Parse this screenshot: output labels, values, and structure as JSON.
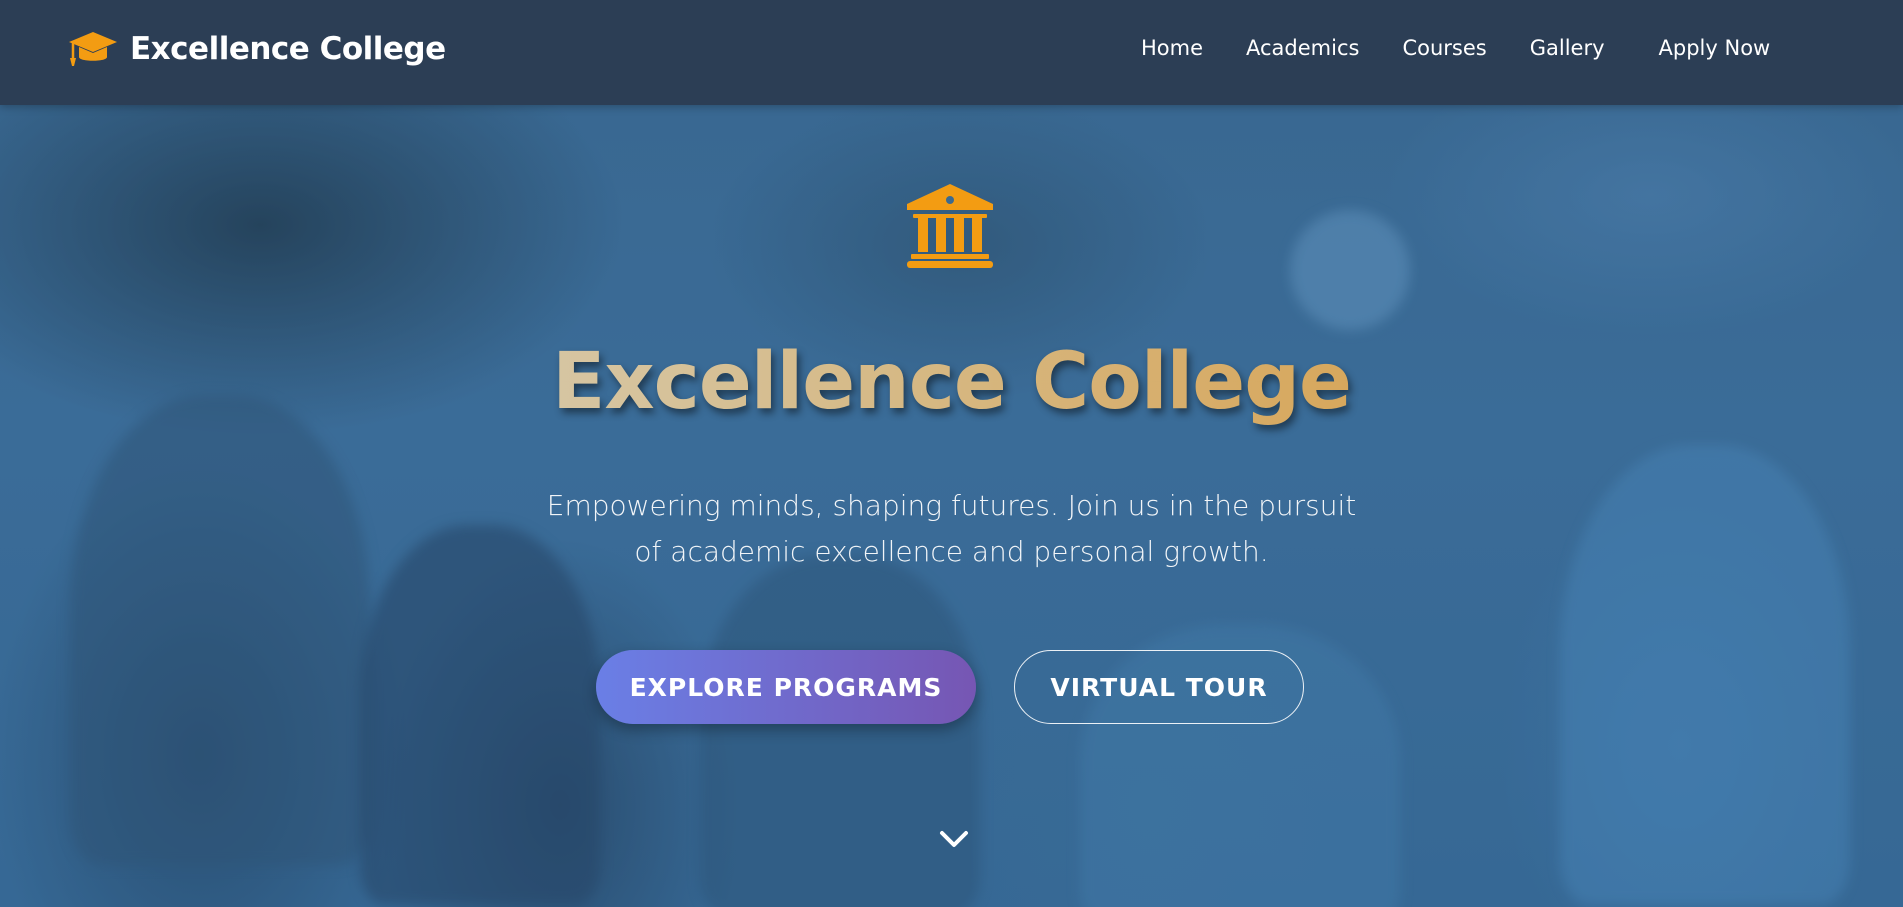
{
  "header": {
    "brand_name": "Excellence College",
    "brand_icon": "graduation-cap-icon",
    "nav": {
      "home": "Home",
      "academics": "Academics",
      "courses": "Courses",
      "gallery": "Gallery",
      "apply": "Apply Now"
    }
  },
  "hero": {
    "icon": "university-building-icon",
    "title": "Excellence College",
    "subtitle_line1": "Empowering minds, shaping futures. Join us in the pursuit",
    "subtitle_line2": "of academic excellence and personal growth.",
    "primary_button": "EXPLORE PROGRAMS",
    "secondary_button": "VIRTUAL TOUR",
    "scroll_icon": "chevron-down-icon"
  },
  "colors": {
    "header_bg": "#2c3e55",
    "accent_orange": "#f39c12",
    "button_gradient_start": "#6a7fe6",
    "button_gradient_end": "#7656b3",
    "hero_tint": "#3b6a90"
  }
}
